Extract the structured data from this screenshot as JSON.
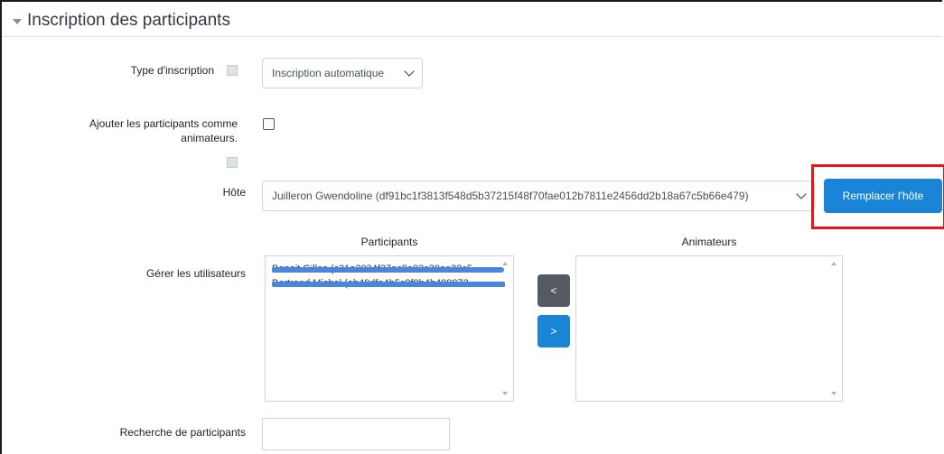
{
  "section": {
    "title": "Inscription des participants"
  },
  "fields": {
    "type_inscription": {
      "label": "Type d'inscription",
      "value": "Inscription automatique"
    },
    "ajouter_animateurs": {
      "label_line1": "Ajouter les participants comme",
      "label_line2": "animateurs.",
      "checked": false
    },
    "hote": {
      "label": "Hôte",
      "value": "Juilleron Gwendoline (df91bc1f3813f548d5b37215f48f70fae012b7811e2456dd2b18a67c5b66e479)",
      "replace_button": "Remplacer l'hôte"
    },
    "gerer_utilisateurs": {
      "label": "Gérer les utilisateurs",
      "participants_header": "Participants",
      "animateurs_header": "Animateurs",
      "participants": [
        "Benoit Gilles (c31a3034f37ac8e93c38ae32c5",
        "Bertrand Michel (ab48dfa4b5c9f8b4b499872"
      ],
      "animateurs": [],
      "move_left_label": "<",
      "move_right_label": ">"
    },
    "recherche": {
      "label": "Recherche de participants",
      "value": ""
    }
  },
  "colors": {
    "primary": "#1a85d6",
    "secondary": "#545b62",
    "highlight": "#e8141b",
    "redaction": "#4a86d9"
  },
  "icons": {
    "collapse": "caret-down-icon",
    "help": "help-icon",
    "dropdown": "chevron-down-icon"
  }
}
